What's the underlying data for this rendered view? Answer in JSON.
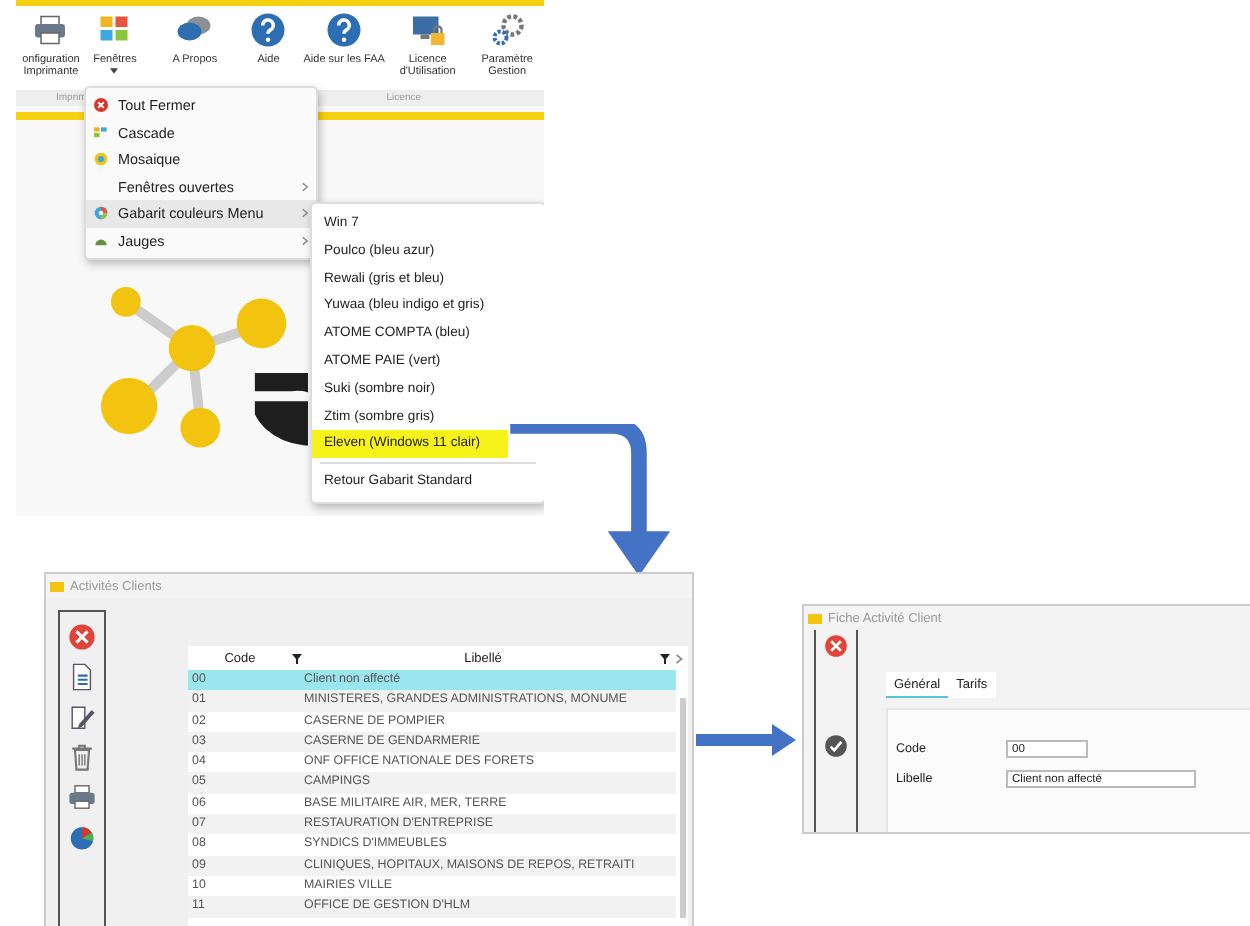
{
  "ribbon": {
    "buttons": [
      {
        "label": "onfiguration Imprimante"
      },
      {
        "label": "Fenêtres",
        "dropdown": true
      },
      {
        "label": "A Propos"
      },
      {
        "label": "Aide"
      },
      {
        "label": "Aide sur les FAA"
      },
      {
        "label": "Licence d'Utilisation"
      },
      {
        "label": "Paramètre Gestion"
      }
    ],
    "groups": [
      "Imprim",
      "Licence"
    ]
  },
  "menu": {
    "items": [
      {
        "label": "Tout Fermer",
        "submenu": false,
        "selected": false
      },
      {
        "label": "Cascade",
        "submenu": false,
        "selected": false
      },
      {
        "label": "Mosaique",
        "submenu": false,
        "selected": false
      },
      {
        "label": "Fenêtres ouvertes",
        "submenu": true,
        "selected": false
      },
      {
        "label": "Gabarit couleurs Menu",
        "submenu": true,
        "selected": true
      },
      {
        "label": "Jauges",
        "submenu": true,
        "selected": false
      }
    ]
  },
  "submenu": {
    "items": [
      {
        "label": "Win 7",
        "selected": false
      },
      {
        "label": "Poulco (bleu azur)",
        "selected": false
      },
      {
        "label": "Rewali (gris et bleu)",
        "selected": false
      },
      {
        "label": "Yuwaa (bleu indigo et gris)",
        "selected": false
      },
      {
        "label": "ATOME COMPTA (bleu)",
        "selected": false
      },
      {
        "label": "ATOME PAIE (vert)",
        "selected": false
      },
      {
        "label": "Suki (sombre noir)",
        "selected": false
      },
      {
        "label": "Ztim (sombre gris)",
        "selected": false
      },
      {
        "label": "Eleven (Windows 11 clair)",
        "selected": true
      }
    ],
    "footer": "Retour Gabarit Standard"
  },
  "list_window": {
    "title": "Activités Clients",
    "table": {
      "columns": [
        "Code",
        "Libellé"
      ],
      "rows": [
        {
          "code": "00",
          "label": "Client non affecté",
          "selected": true
        },
        {
          "code": "01",
          "label": "MINISTERES, GRANDES ADMINISTRATIONS, MONUME",
          "selected": false
        },
        {
          "code": "02",
          "label": "CASERNE DE POMPIER",
          "selected": false
        },
        {
          "code": "03",
          "label": "CASERNE DE GENDARMERIE",
          "selected": false
        },
        {
          "code": "04",
          "label": "ONF OFFICE NATIONALE DES FORETS",
          "selected": false
        },
        {
          "code": "05",
          "label": "CAMPINGS",
          "selected": false
        },
        {
          "code": "06",
          "label": "BASE MILITAIRE AIR, MER, TERRE",
          "selected": false
        },
        {
          "code": "07",
          "label": "RESTAURATION D'ENTREPRISE",
          "selected": false
        },
        {
          "code": "08",
          "label": "SYNDICS D'IMMEUBLES",
          "selected": false
        },
        {
          "code": "09",
          "label": "CLINIQUES, HOPITAUX, MAISONS DE REPOS, RETRAITI",
          "selected": false
        },
        {
          "code": "10",
          "label": "MAIRIES VILLE",
          "selected": false
        },
        {
          "code": "11",
          "label": "OFFICE DE GESTION D'HLM",
          "selected": false
        }
      ]
    }
  },
  "form_window": {
    "title": "Fiche Activité Client",
    "tabs": [
      {
        "label": "Général",
        "selected": true
      },
      {
        "label": "Tarifs",
        "selected": false
      }
    ],
    "fields": [
      {
        "label": "Code",
        "value": "00"
      },
      {
        "label": "Libelle",
        "value": "Client non affecté"
      }
    ]
  }
}
